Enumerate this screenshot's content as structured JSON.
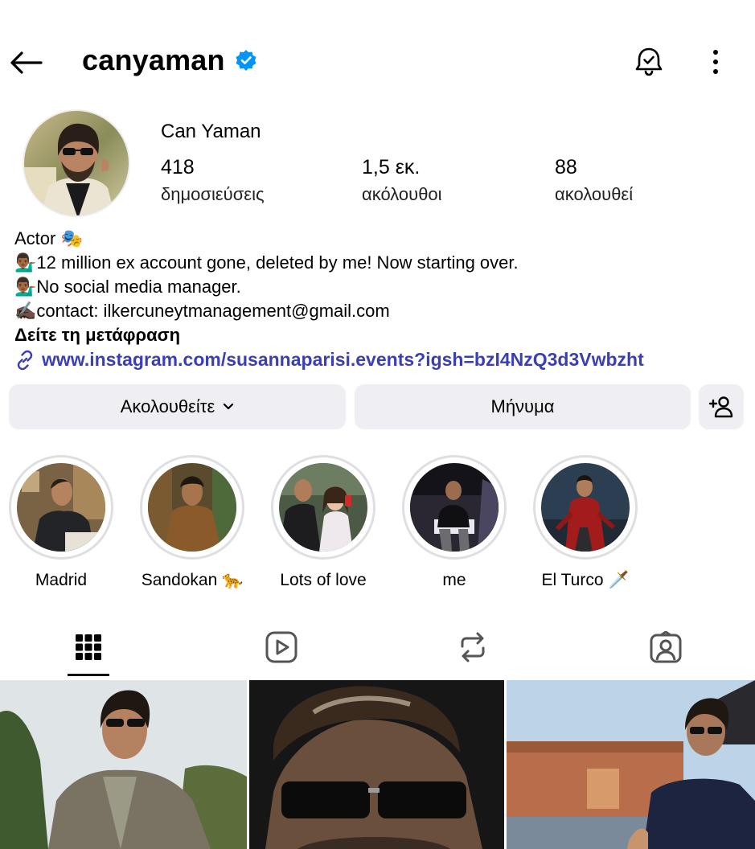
{
  "header": {
    "username": "canyaman",
    "icons": {
      "back": "back-arrow-icon",
      "verified": "verified-badge-icon",
      "notifications": "notification-bell-icon",
      "more": "more-options-icon"
    },
    "accent": "#0095f6"
  },
  "profile": {
    "full_name": "Can Yaman",
    "stats": [
      {
        "value": "418",
        "label": "δημοσιεύσεις"
      },
      {
        "value": "1,5 εκ.",
        "label": "ακόλουθοι"
      },
      {
        "value": "88",
        "label": "ακολουθεί"
      }
    ]
  },
  "bio": {
    "line1_text": "Actor ",
    "line1_emoji": "🎭",
    "line2_emoji": "💁🏾‍♂️",
    "line2_text": "12 million ex account gone, deleted by me! Now starting over.",
    "line3_emoji": "💁🏾‍♂️",
    "line3_text": "No social media manager.",
    "line4_emoji": "✍🏿",
    "line4_text": "contact: ilkercuneytmanagement@gmail.com",
    "translate": "Δείτε τη μετάφραση",
    "link": "www.instagram.com/susannaparisi.events?igsh=bzI4NzQ3d3Vwbzht",
    "link_color": "#3b3fb5"
  },
  "actions": {
    "following": "Ακολουθείτε",
    "message": "Μήνυμα",
    "add_user_icon": "add-person-icon"
  },
  "highlights": [
    {
      "label": "Madrid"
    },
    {
      "label": "Sandokan 🐆"
    },
    {
      "label": "Lots of love"
    },
    {
      "label": "me"
    },
    {
      "label": "El Turco 🗡️"
    }
  ],
  "tabs": [
    {
      "icon": "grid-icon",
      "selected": true
    },
    {
      "icon": "reels-icon",
      "selected": false
    },
    {
      "icon": "reposts-icon",
      "selected": false
    },
    {
      "icon": "tagged-icon",
      "selected": false
    }
  ]
}
